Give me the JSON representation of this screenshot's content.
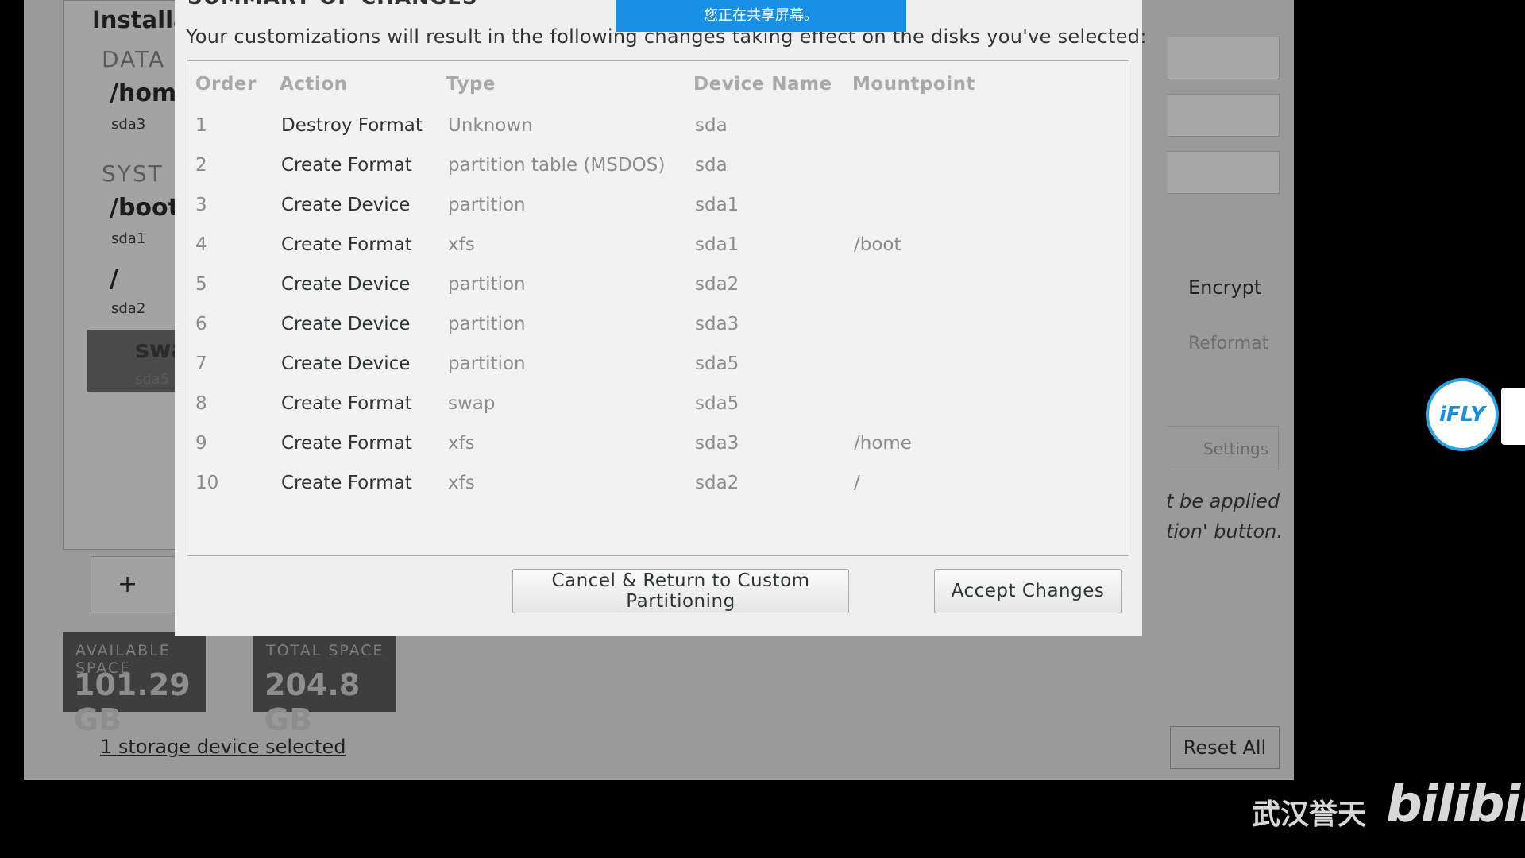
{
  "installer": {
    "heading": "Installa",
    "data_section": "DATA",
    "system_section": "SYST",
    "mounts": [
      {
        "name": "/hom",
        "device": "sda3"
      },
      {
        "name": "/boot",
        "device": "sda1"
      },
      {
        "name": "/",
        "device": "sda2"
      },
      {
        "name": "swap",
        "device": "sda5"
      }
    ],
    "add_button": "+",
    "remove_button": "−",
    "available_space_label": "AVAILABLE SPACE",
    "available_space_value": "101.29 GB",
    "total_space_label": "TOTAL SPACE",
    "total_space_value": "204.8 GB",
    "storage_link": "1 storage device selected",
    "reset_button": "Reset All",
    "encrypt_label": "Encrypt",
    "reformat_label": "Reformat",
    "settings_button": "Settings",
    "note_line1": "t be applied",
    "note_line2": "tion' button."
  },
  "dialog": {
    "title": "SUMMARY OF CHANGES",
    "description": "Your customizations will result in the following changes taking effect on the disks you've selected:",
    "columns": {
      "order": "Order",
      "action": "Action",
      "type": "Type",
      "device": "Device Name",
      "mountpoint": "Mountpoint"
    },
    "rows": [
      {
        "order": "1",
        "action": "Destroy Format",
        "type": "Unknown",
        "device": "sda",
        "mountpoint": ""
      },
      {
        "order": "2",
        "action": "Create Format",
        "type": "partition table (MSDOS)",
        "device": "sda",
        "mountpoint": ""
      },
      {
        "order": "3",
        "action": "Create Device",
        "type": "partition",
        "device": "sda1",
        "mountpoint": ""
      },
      {
        "order": "4",
        "action": "Create Format",
        "type": "xfs",
        "device": "sda1",
        "mountpoint": "/boot"
      },
      {
        "order": "5",
        "action": "Create Device",
        "type": "partition",
        "device": "sda2",
        "mountpoint": ""
      },
      {
        "order": "6",
        "action": "Create Device",
        "type": "partition",
        "device": "sda3",
        "mountpoint": ""
      },
      {
        "order": "7",
        "action": "Create Device",
        "type": "partition",
        "device": "sda5",
        "mountpoint": ""
      },
      {
        "order": "8",
        "action": "Create Format",
        "type": "swap",
        "device": "sda5",
        "mountpoint": ""
      },
      {
        "order": "9",
        "action": "Create Format",
        "type": "xfs",
        "device": "sda3",
        "mountpoint": "/home"
      },
      {
        "order": "10",
        "action": "Create Format",
        "type": "xfs",
        "device": "sda2",
        "mountpoint": "/"
      }
    ],
    "cancel_button": "Cancel & Return to Custom Partitioning",
    "accept_button": "Accept Changes"
  },
  "overlays": {
    "share_banner": "您正在共享屏幕。",
    "ifly_badge": "iFLY",
    "watermark_text": "武汉誉天",
    "watermark_logo": "bilibili"
  }
}
